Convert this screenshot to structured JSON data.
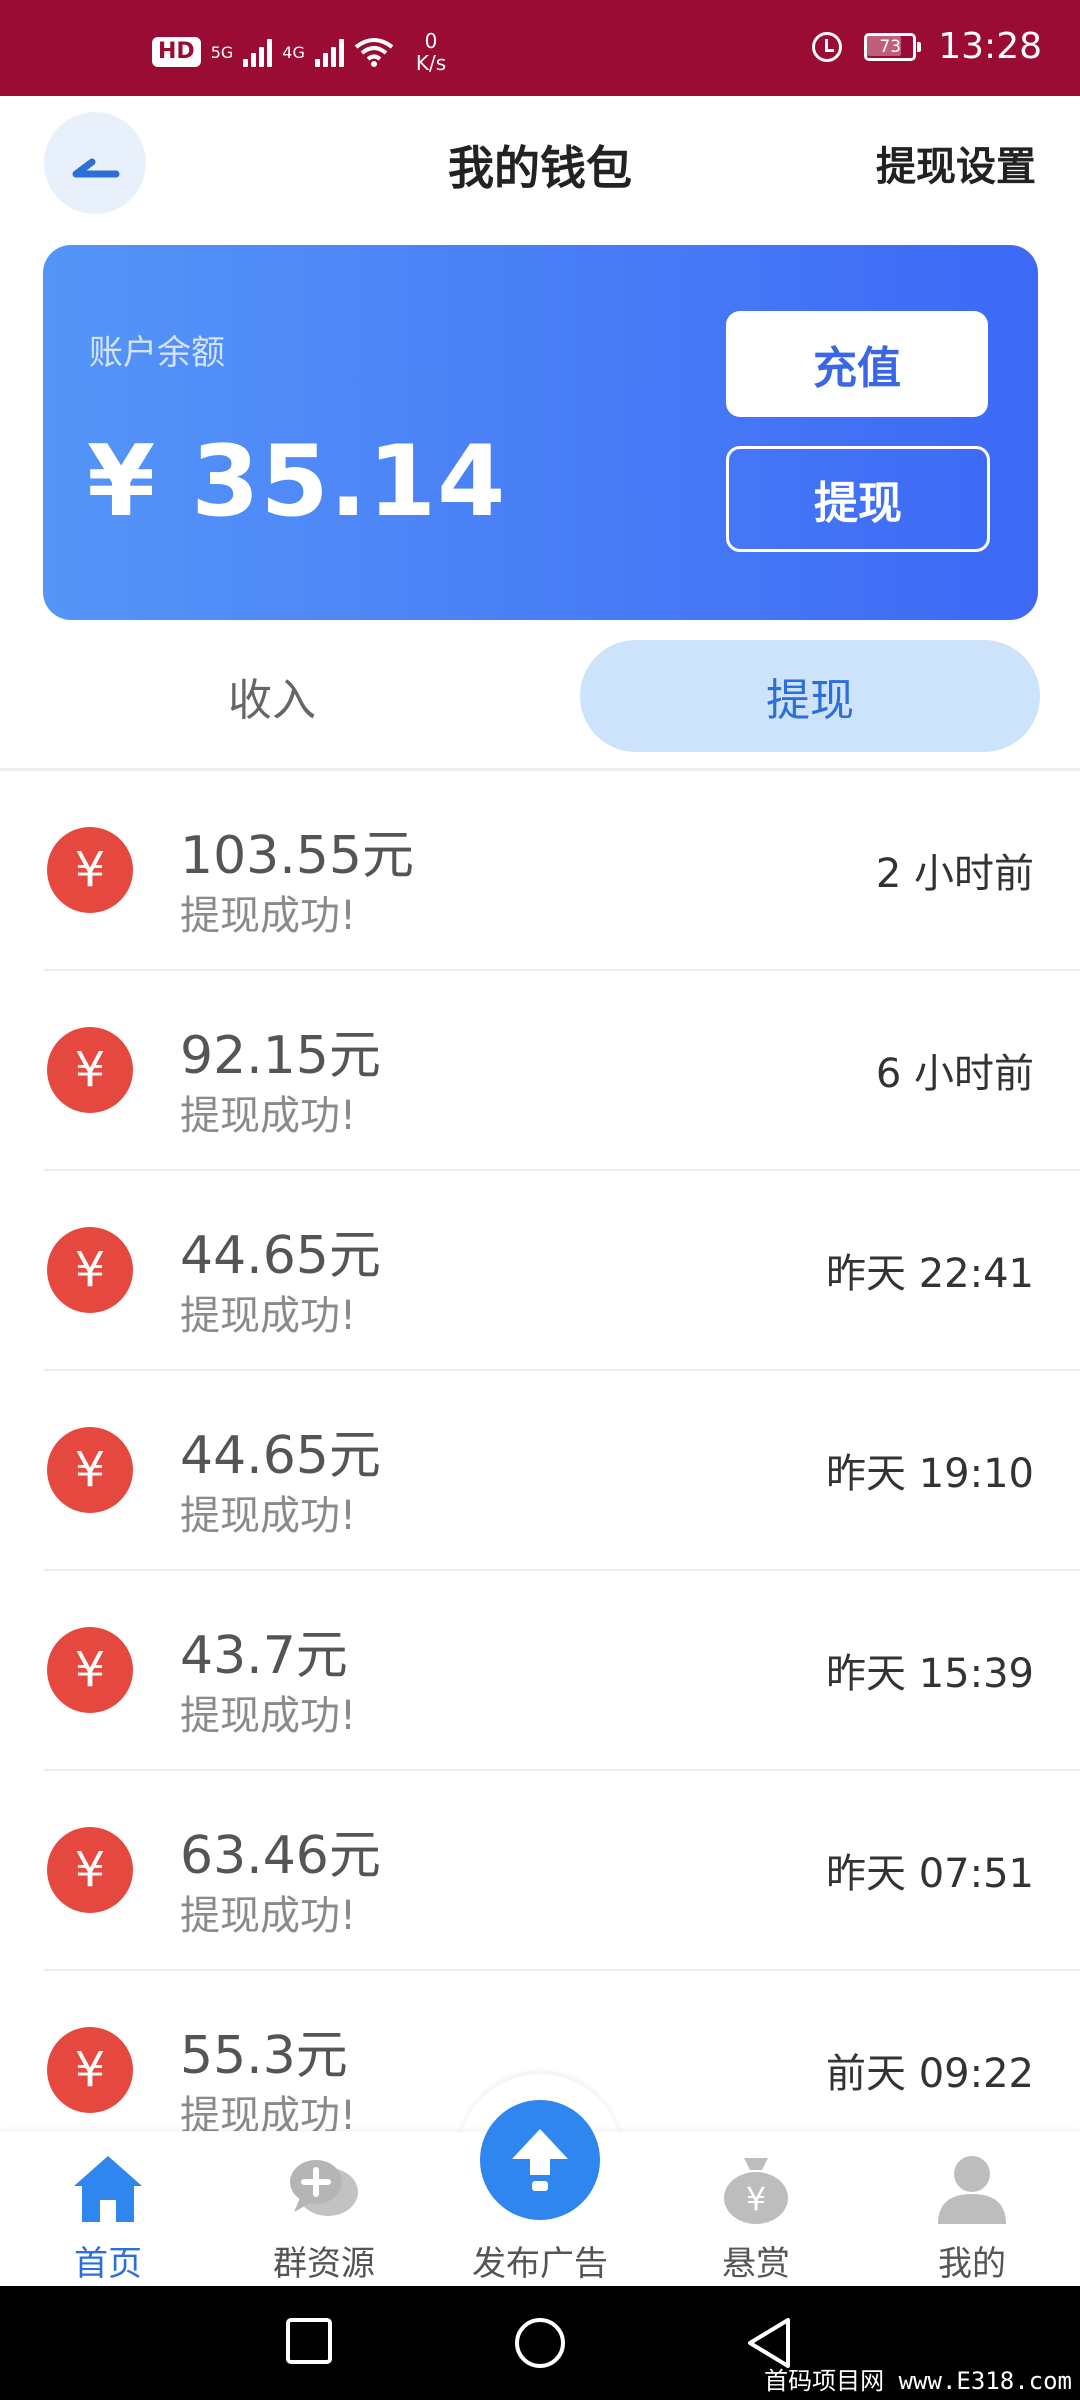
{
  "status_bar": {
    "hd": "HD",
    "sim1": "5G",
    "sim2": "4G",
    "net_speed_value": "0",
    "net_speed_unit": "K/s",
    "battery": "73",
    "time": "13:28"
  },
  "header": {
    "title": "我的钱包",
    "settings_label": "提现设置"
  },
  "balance": {
    "label": "账户余额",
    "amount": "¥ 35.14",
    "recharge_label": "充值",
    "withdraw_label": "提现"
  },
  "tabs": {
    "income": "收入",
    "withdraw": "提现",
    "active": "withdraw"
  },
  "records": [
    {
      "amount": "103.55元",
      "status": "提现成功!",
      "time": "2 小时前"
    },
    {
      "amount": "92.15元",
      "status": "提现成功!",
      "time": "6 小时前"
    },
    {
      "amount": "44.65元",
      "status": "提现成功!",
      "time": "昨天 22:41"
    },
    {
      "amount": "44.65元",
      "status": "提现成功!",
      "time": "昨天 19:10"
    },
    {
      "amount": "43.7元",
      "status": "提现成功!",
      "time": "昨天 15:39"
    },
    {
      "amount": "63.46元",
      "status": "提现成功!",
      "time": "昨天 07:51"
    },
    {
      "amount": "55.3元",
      "status": "提现成功!",
      "time": "前天 09:22"
    }
  ],
  "record_icon": "¥",
  "bottom_nav": {
    "home": "首页",
    "groups": "群资源",
    "publish": "发布广告",
    "reward": "悬赏",
    "mine": "我的",
    "active": "home"
  },
  "watermark": "首码项目网 www.E318.com",
  "colors": {
    "status_bar": "#9b0c35",
    "card_start": "#5595f7",
    "card_end": "#3d69f6",
    "accent": "#2c6fd9",
    "record_icon": "#e4483e"
  }
}
